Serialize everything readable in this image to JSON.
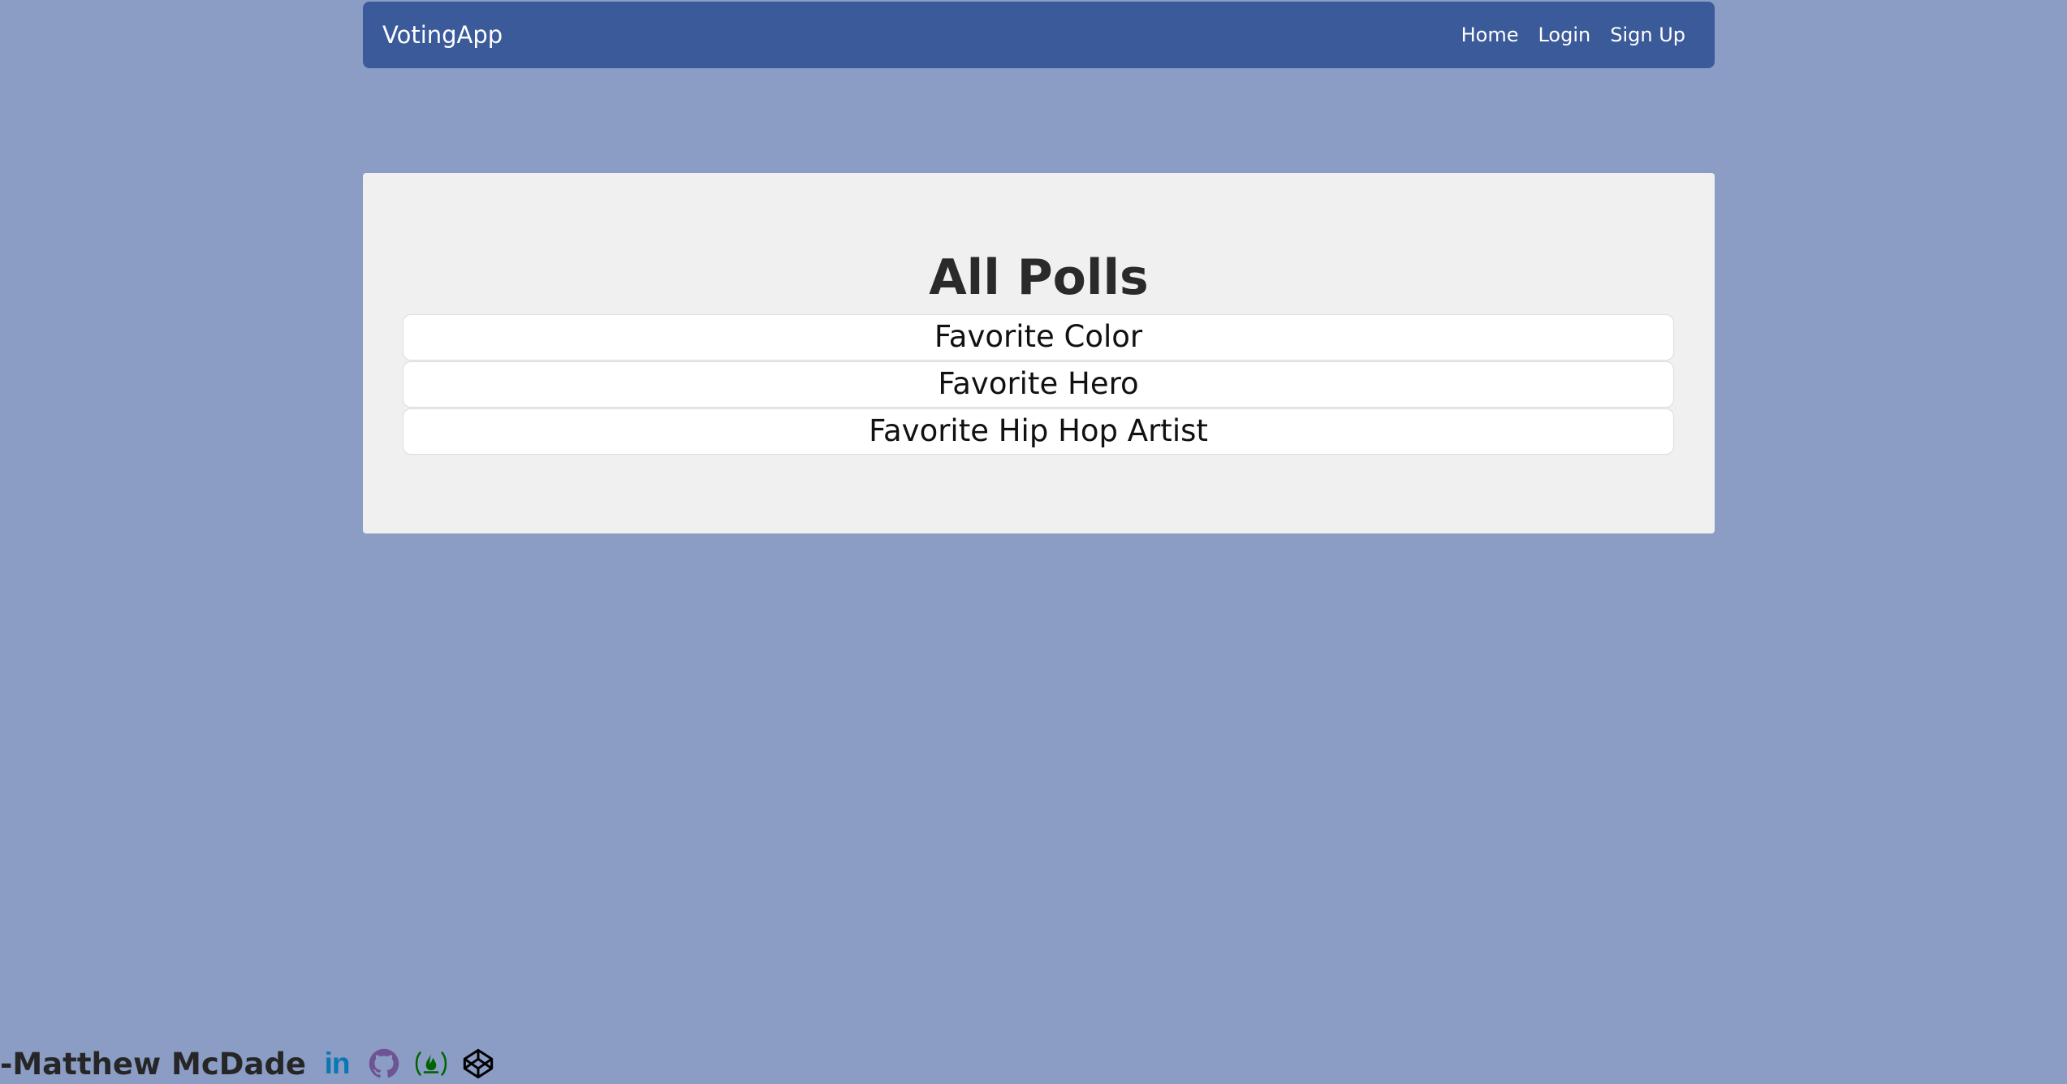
{
  "navbar": {
    "brand": "VotingApp",
    "links": [
      {
        "label": "Home"
      },
      {
        "label": "Login"
      },
      {
        "label": "Sign Up"
      }
    ]
  },
  "main": {
    "title": "All Polls",
    "polls": [
      {
        "label": "Favorite Color"
      },
      {
        "label": "Favorite Hero"
      },
      {
        "label": "Favorite Hip Hop Artist"
      }
    ]
  },
  "footer": {
    "author": "-Matthew McDade",
    "icons": [
      {
        "name": "linkedin-icon",
        "glyph": "in",
        "color": "#0a77b5"
      },
      {
        "name": "github-icon",
        "color": "#6e5494"
      },
      {
        "name": "freecodecamp-icon",
        "color": "#006400"
      },
      {
        "name": "codepen-icon",
        "color": "#000000"
      }
    ]
  },
  "colors": {
    "background": "#8b9dc5",
    "navbar": "#3b5a9a",
    "card": "#f0f0f0"
  }
}
